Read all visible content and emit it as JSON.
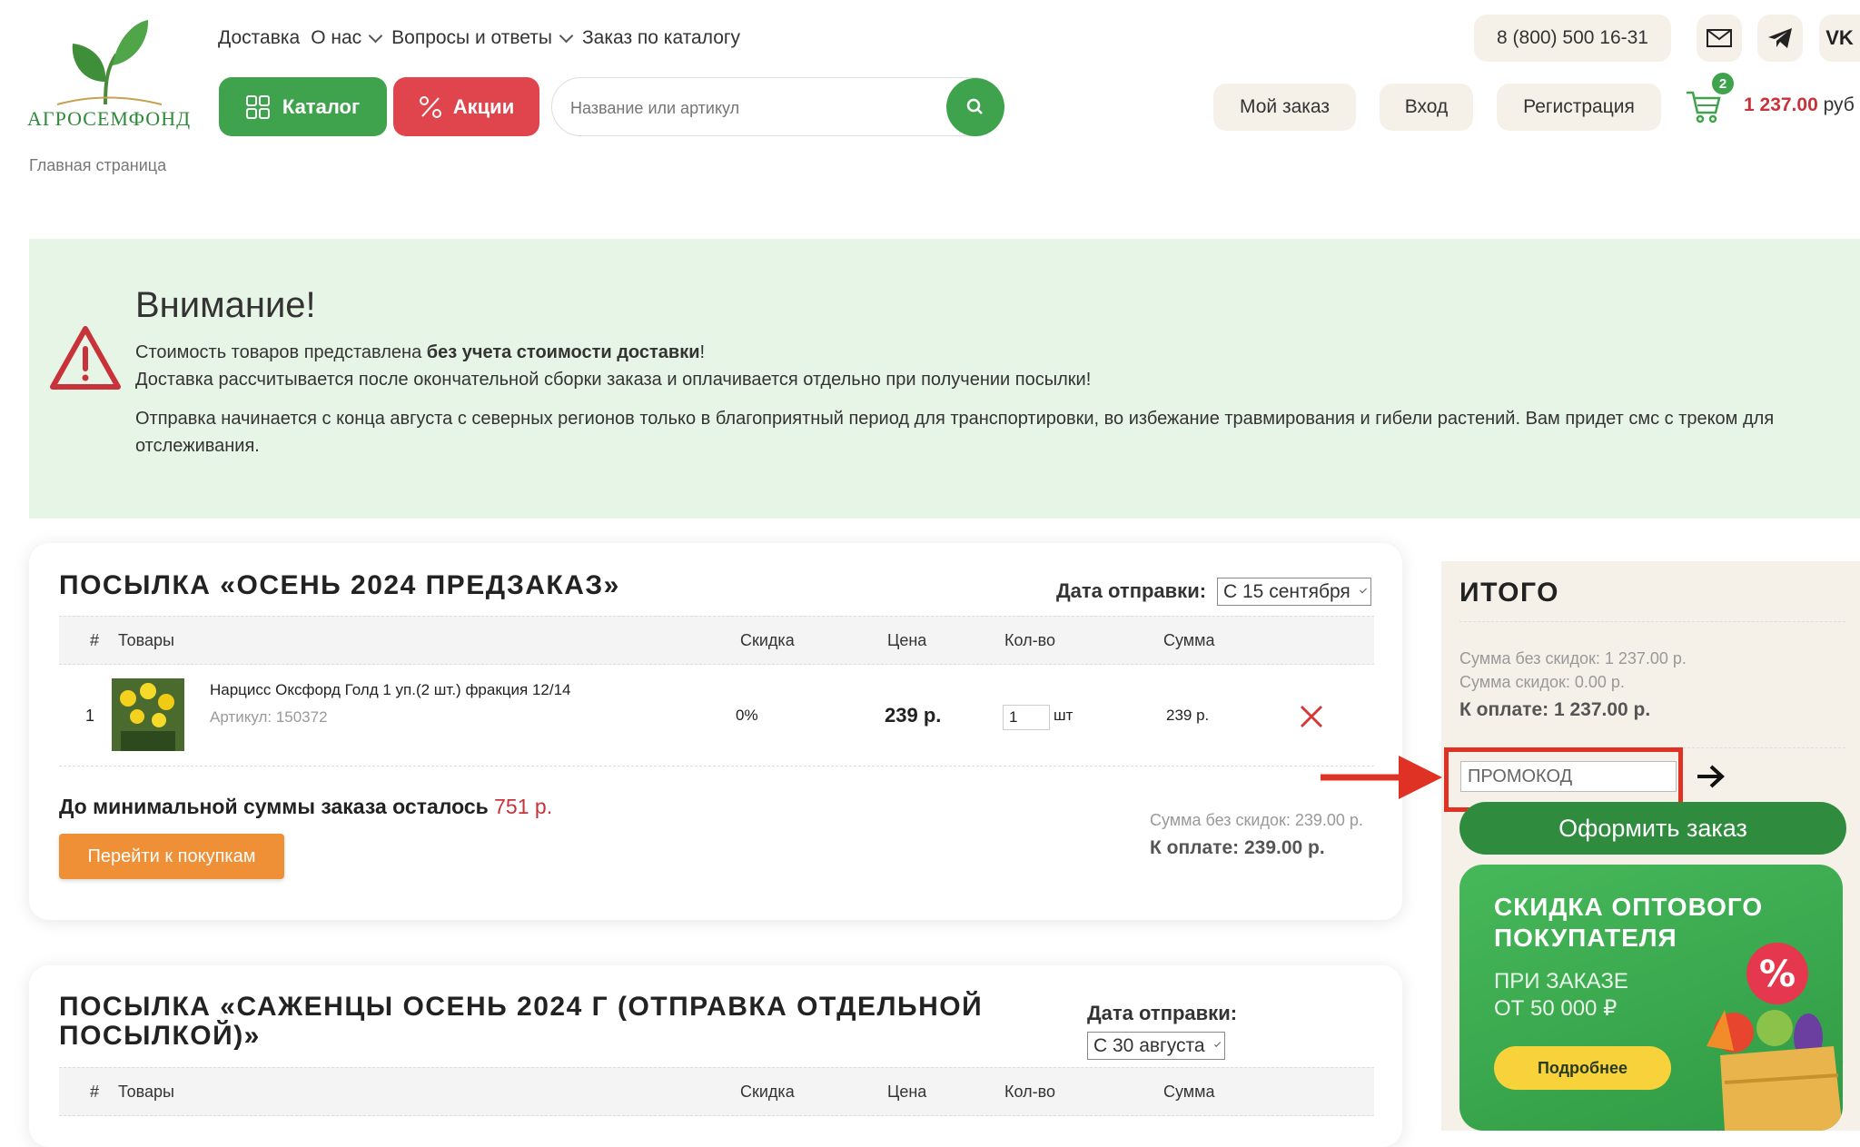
{
  "header": {
    "logo_text": "АГРОСЕМФОНД",
    "nav": [
      {
        "label": "Доставка",
        "has_dropdown": false
      },
      {
        "label": "О нас",
        "has_dropdown": true
      },
      {
        "label": "Вопросы и ответы",
        "has_dropdown": true
      },
      {
        "label": "Заказ по каталогу",
        "has_dropdown": false
      }
    ],
    "catalog_label": "Каталог",
    "promo_label": "Акции",
    "search_placeholder": "Название или артикул",
    "phone": "8 (800) 500 16-31",
    "my_order": "Мой заказ",
    "login": "Вход",
    "register": "Регистрация",
    "cart_count": "2",
    "cart_sum": "1 237.00",
    "cart_currency": "руб"
  },
  "breadcrumb": "Главная страница",
  "notice": {
    "title": "Внимание!",
    "line1_prefix": "Стоимость товаров представлена ",
    "line1_bold": "без учета стоимости доставки",
    "line1_suffix": "!",
    "line2": "Доставка рассчитывается после окончательной сборки заказа и оплачивается отдельно при получении посылки!",
    "line3": "Отправка начинается с конца августа с северных регионов только в благоприятный период для транспортировки, во избежание травмирования и гибели растений. Вам придет смс с треком для отслеживания."
  },
  "table_headers": {
    "num": "#",
    "goods": "Товары",
    "discount": "Скидка",
    "price": "Цена",
    "qty": "Кол-во",
    "sum": "Сумма"
  },
  "parcel1": {
    "title": "Посылка «Осень 2024 предзаказ»",
    "ship_label": "Дата отправки:",
    "ship_value": "С 15 сентября",
    "item": {
      "num": "1",
      "name": "Нарцисс Оксфорд Голд 1 уп.(2 шт.) фракция 12/14",
      "article": "Артикул: 150372",
      "discount": "0%",
      "price": "239 р.",
      "qty": "1",
      "unit": "шт",
      "sum": "239 р."
    },
    "min_left_text": "До минимальной суммы заказа осталось",
    "min_left_value": "751 р.",
    "shop_button": "Перейти к покупкам",
    "sum_no_discount": "Сумма без скидок: 239.00 р.",
    "to_pay": "К оплате: 239.00 р."
  },
  "parcel2": {
    "title_line1": "Посылка «Саженцы осень 2024 г (отправка отдельной",
    "title_line2": "посылкой)»",
    "ship_label": "Дата отправки:",
    "ship_value": "С 30 августа"
  },
  "summary": {
    "title": "Итого",
    "sum_no_discount": "Сумма без скидок: 1 237.00 р.",
    "sum_discount": "Сумма скидок: 0.00 р.",
    "to_pay": "К оплате: 1 237.00 р.",
    "promo_placeholder": "ПРОМОКОД",
    "checkout": "Оформить заказ"
  },
  "banner": {
    "title_line1": "Скидка оптового",
    "title_line2": "покупателя",
    "sub_line1": "ПРИ ЗАКАЗЕ",
    "sub_line2": "ОТ 50 000 ₽",
    "button": "Подробнее"
  },
  "colors": {
    "green": "#3fa34d",
    "red": "#e0454e",
    "orange": "#ef8f36",
    "notice_bg": "#e6f5e5",
    "annotation_red": "#e03224"
  }
}
